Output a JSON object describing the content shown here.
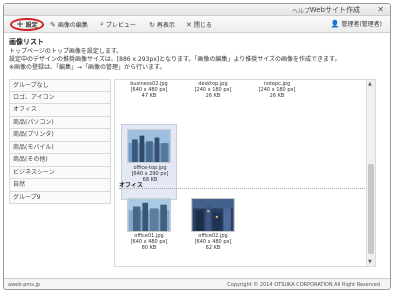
{
  "titlebar": {
    "help": "ヘルプ",
    "site_title": "Webサイト作成",
    "close": "✕"
  },
  "toolbar": {
    "add": "設定",
    "edit": "画像の編集",
    "preview": "プレビュー",
    "refresh": "再表示",
    "close": "閉じる",
    "user": "管理者(管理者)"
  },
  "main": {
    "title": "画像リスト",
    "desc_lines": [
      "トップページのトップ画像を設定します。",
      "設定中のデザインの推奨画像サイズは、[886 x 293px]となります。「画像の編集」より推奨サイズの画像を作成できます。",
      "※画像の登録は、「編集」→「画像の管理」から行います。"
    ]
  },
  "categories": [
    "グループなし",
    "ロゴ、アイコン",
    "オフィス",
    "商品(パソコン)",
    "商品(プリンタ)",
    "商品(モバイル)",
    "商品(その他)",
    "ビジネスシーン",
    "自然",
    "グループ9"
  ],
  "images_top": [
    {
      "name": "business02.jpg",
      "size": "[640 x 480 px]",
      "kb": "47 KB"
    },
    {
      "name": "desktop.jpg",
      "size": "[240 x 180 px]",
      "kb": "26 KB"
    },
    {
      "name": "notepc.jpg",
      "size": "[240 x 180 px]",
      "kb": "26 KB"
    }
  ],
  "images_mid": [
    {
      "name": "office-top.jpg",
      "size": "[640 x 290 px]",
      "kb": "68 KB"
    }
  ],
  "office_section": {
    "label": "オフィス",
    "images": [
      {
        "name": "office01.jpg",
        "size": "[640 x 480 px]",
        "kb": "80 KB"
      },
      {
        "name": "office02.jpg",
        "size": "[640 x 480 px]",
        "kb": "82 KB"
      }
    ]
  },
  "footer": {
    "left": "aweb-pms.jp",
    "right": "Copyright © 2014 OTSUKA CORPORATION All Right Reserved"
  }
}
